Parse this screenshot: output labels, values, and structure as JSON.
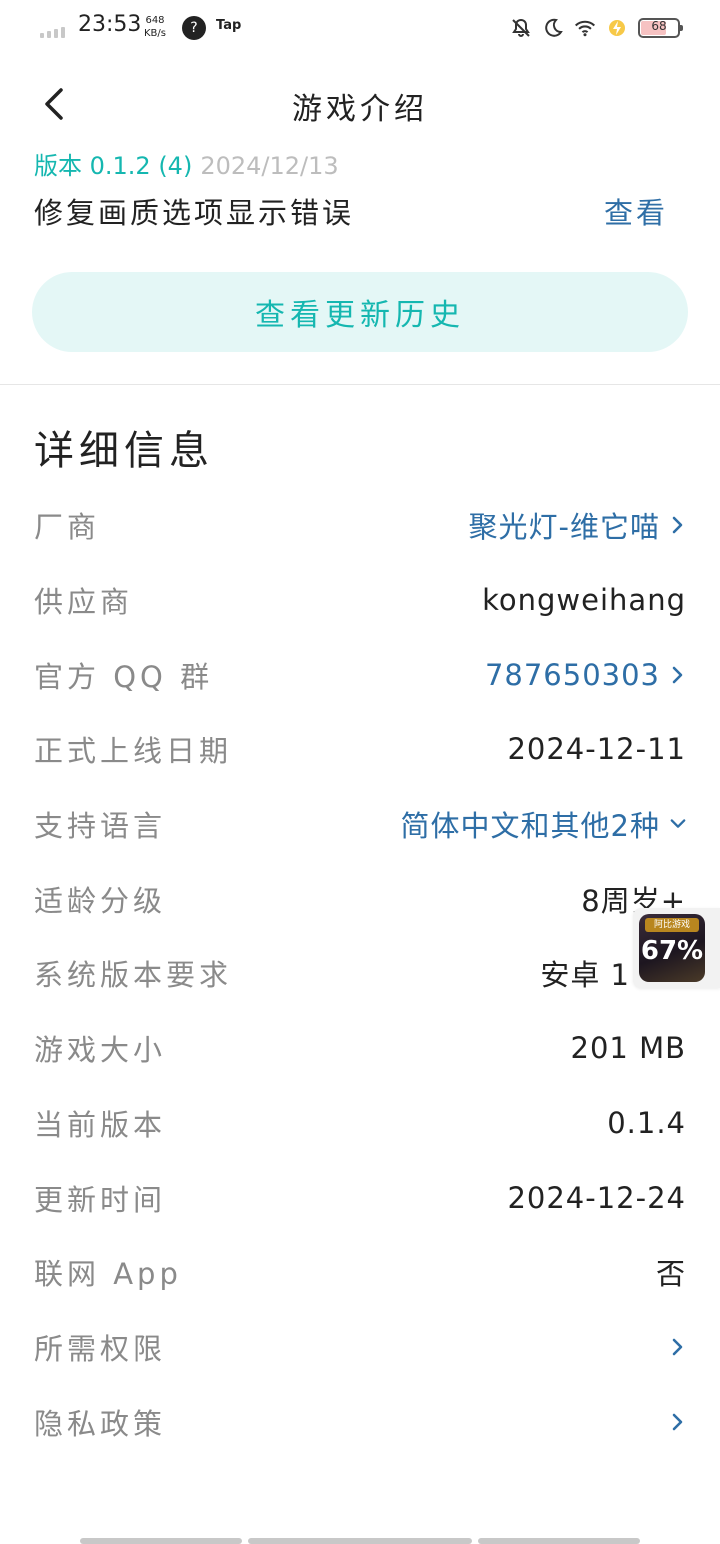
{
  "status_bar": {
    "time": "23:53",
    "net_speed_value": "648",
    "net_speed_unit": "KB/s",
    "app_label": "Tap",
    "battery": "68"
  },
  "header": {
    "title": "游戏介绍"
  },
  "version": {
    "label": "版本 0.1.2 (4)",
    "date": "2024/12/13",
    "note": "修复画质选项显示错误",
    "view_link": "查看"
  },
  "history_button": "查看更新历史",
  "details": {
    "title": "详细信息",
    "rows": [
      {
        "label": "厂商",
        "value": "聚光灯-维它喵"
      },
      {
        "label": "供应商",
        "value": "kongweihang"
      },
      {
        "label": "官方 QQ 群",
        "value": "787650303"
      },
      {
        "label": "正式上线日期",
        "value": "2024-12-11"
      },
      {
        "label": "支持语言",
        "value": "简体中文和其他2种"
      },
      {
        "label": "适龄分级",
        "value": "8周岁+"
      },
      {
        "label": "系统版本要求",
        "value": "安卓 1"
      },
      {
        "label": "游戏大小",
        "value": "201 MB"
      },
      {
        "label": "当前版本",
        "value": "0.1.4"
      },
      {
        "label": "更新时间",
        "value": "2024-12-24"
      },
      {
        "label": "联网 App",
        "value": "否"
      },
      {
        "label": "所需权限",
        "value": ""
      },
      {
        "label": "隐私政策",
        "value": ""
      }
    ]
  },
  "float_widget": {
    "percent": "67%",
    "banner": "阿比游戏"
  },
  "colors": {
    "accent_teal": "#15b7b0",
    "link_blue": "#2e6ea6",
    "label_gray": "#8a8a8a",
    "button_bg": "#e4f7f6"
  }
}
